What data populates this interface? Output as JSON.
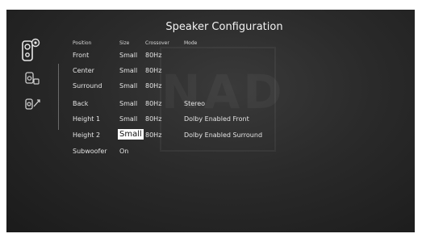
{
  "title": "Speaker Configuration",
  "watermark": "NAD",
  "sidebar": {
    "icons": [
      "speakers-icon",
      "subwoofer-icon",
      "speaker-levels-icon"
    ]
  },
  "columns": [
    "Position",
    "Size",
    "Crossover",
    "Mode"
  ],
  "rows": [
    {
      "position": "Front",
      "size": "Small",
      "crossover": "80Hz",
      "mode": ""
    },
    {
      "position": "Center",
      "size": "Small",
      "crossover": "80Hz",
      "mode": ""
    },
    {
      "position": "Surround",
      "size": "Small",
      "crossover": "80Hz",
      "mode": ""
    },
    {
      "position": "Back",
      "size": "Small",
      "crossover": "80Hz",
      "mode": "Stereo"
    },
    {
      "position": "Height 1",
      "size": "Small",
      "crossover": "80Hz",
      "mode": "Dolby Enabled Front"
    },
    {
      "position": "Height 2",
      "size": "Small",
      "crossover": "80Hz",
      "mode": "Dolby Enabled Surround"
    },
    {
      "position": "Subwoofer",
      "size": "On",
      "crossover": "",
      "mode": ""
    }
  ],
  "selected": {
    "row": 5,
    "column": "size"
  },
  "colors": {
    "background": "#2a2a2a",
    "text": "#e4e4e4",
    "highlight": "#ffffff"
  }
}
